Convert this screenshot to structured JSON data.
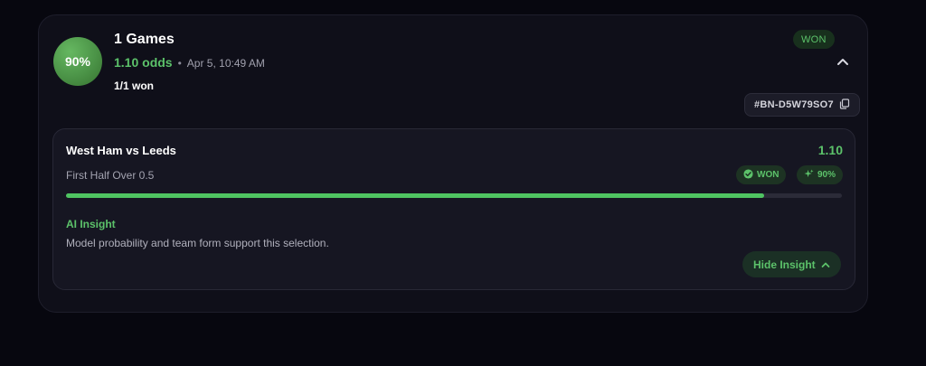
{
  "bet": {
    "confidence": "90%",
    "title": "1 Games",
    "odds": "1.10 odds",
    "separator": "•",
    "timestamp": "Apr 5, 10:49 AM",
    "result_count": "1/1 won",
    "status": "WON",
    "reference": "#BN-D5W79SO7"
  },
  "selection": {
    "match": "West Ham vs Leeds",
    "odds": "1.10",
    "market": "First Half Over 0.5",
    "status": "WON",
    "confidence": "90%",
    "progress": 0.9,
    "insight_title": "AI Insight",
    "insight_text": "Model probability and team form support this selection.",
    "hide_label": "Hide Insight"
  },
  "icons": {
    "collapse": "chevron-up-icon",
    "copy": "copy-icon",
    "check": "check-circle-icon",
    "sparkle": "sparkle-icon"
  },
  "colors": {
    "accent": "#5cc26a",
    "background": "#07070f",
    "card": "#0f0f19"
  }
}
